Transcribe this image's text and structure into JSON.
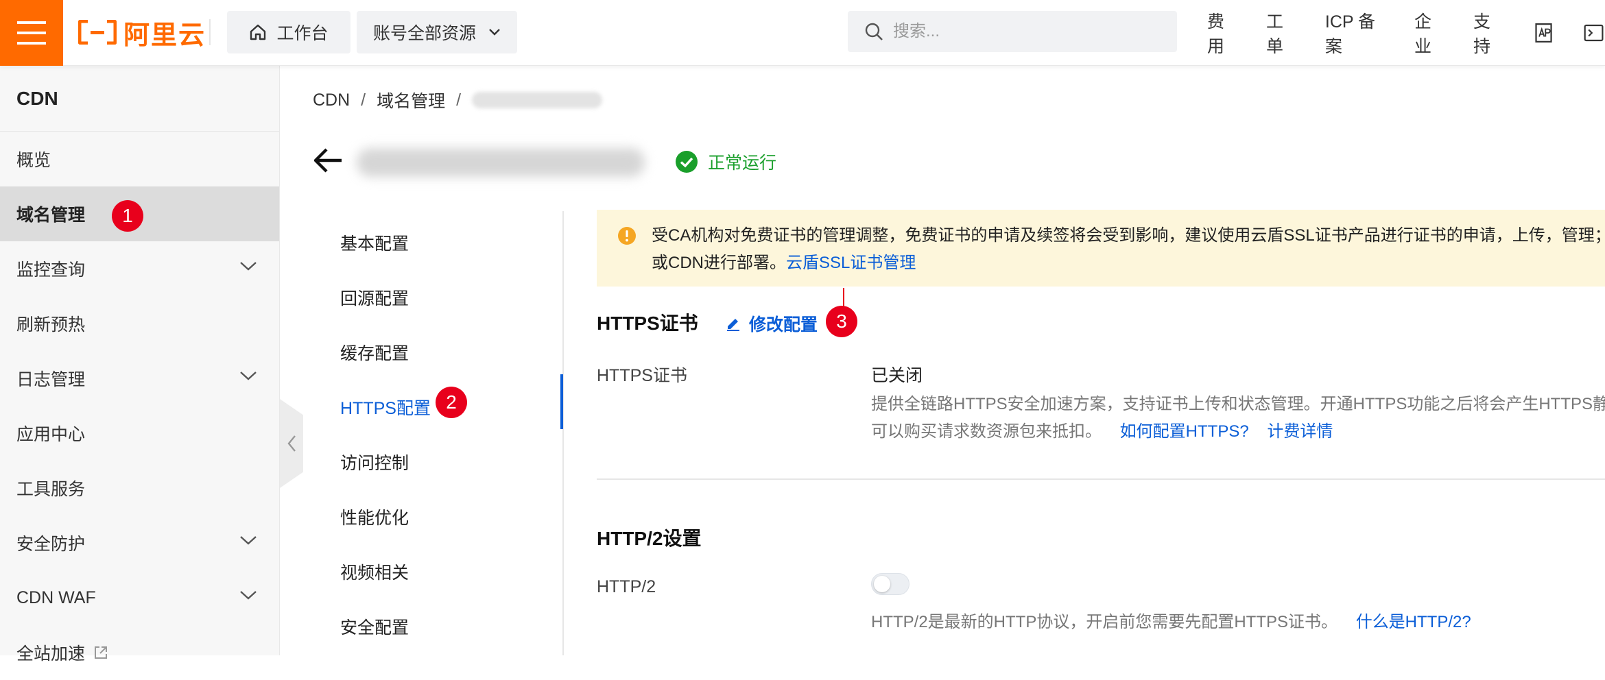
{
  "topbar": {
    "logo_text": "阿里云",
    "workbench_label": "工作台",
    "resources_label": "账号全部资源",
    "search_placeholder": "搜索...",
    "nav": [
      "费用",
      "工单",
      "ICP 备案",
      "企业",
      "支持"
    ]
  },
  "sidebar": {
    "title": "CDN",
    "items": [
      {
        "label": "概览"
      },
      {
        "label": "域名管理",
        "badge": "1"
      },
      {
        "label": "监控查询"
      },
      {
        "label": "刷新预热"
      },
      {
        "label": "日志管理"
      },
      {
        "label": "应用中心"
      },
      {
        "label": "工具服务"
      },
      {
        "label": "安全防护"
      },
      {
        "label": "CDN WAF"
      },
      {
        "label": "全站加速"
      }
    ]
  },
  "breadcrumb": [
    "CDN",
    "域名管理"
  ],
  "domain_status": "正常运行",
  "config_nav": {
    "items": [
      "基本配置",
      "回源配置",
      "缓存配置",
      "HTTPS配置",
      "访问控制",
      "性能优化",
      "视频相关",
      "安全配置"
    ],
    "active_badge": "2"
  },
  "notice": {
    "line1": "受CA机构对免费证书的管理调整，免费证书的申请及续签将会受到影响，建议使用云盾SSL证书产品进行证书的申请，上传，管理；",
    "line2": "或CDN进行部署。",
    "link": "云盾SSL证书管理"
  },
  "https": {
    "section_title": "HTTPS证书",
    "edit_label": "修改配置",
    "edit_badge": "3",
    "field_label": "HTTPS证书",
    "field_value": "已关闭",
    "desc_line1": "提供全链路HTTPS安全加速方案，支持证书上传和状态管理。开通HTTPS功能之后将会产生HTTPS静",
    "desc_line2": "可以购买请求数资源包来抵扣。",
    "link1": "如何配置HTTPS?",
    "link2": "计费详情"
  },
  "http2": {
    "section_title": "HTTP/2设置",
    "field_label": "HTTP/2",
    "enabled": false,
    "desc": "HTTP/2是最新的HTTP协议，开启前您需要先配置HTTPS证书。",
    "link": "什么是HTTP/2?"
  },
  "colors": {
    "brand": "#ff6a00",
    "link": "#0b5ed7",
    "success": "#1a9f2b",
    "badge": "#e8001c",
    "notice_bg": "#fdf6db"
  }
}
